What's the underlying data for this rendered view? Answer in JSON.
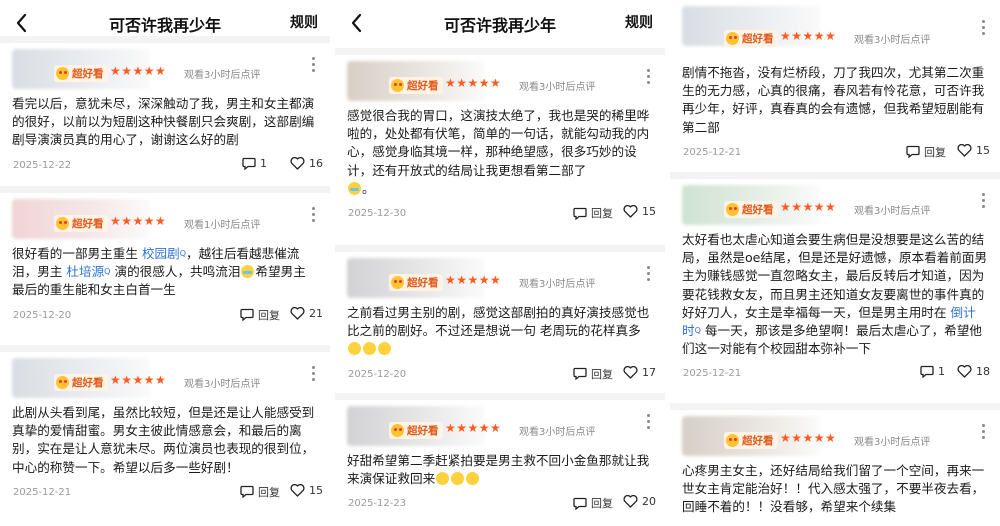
{
  "header": {
    "title": "可否许我再少年",
    "rules_label": "规则"
  },
  "rating_badge": "超好看",
  "stars": "★★★★★",
  "reply_label": "回复",
  "panels": [
    {
      "cards": [
        {
          "time_ago": "观看3小时后点评",
          "text": "看完以后，意犹未尽，深深触动了我，男主和女主都演的很好，以前以为短剧这种快餐剧只会爽剧，这部剧编剧导演演员真的用心了，谢谢这么好的剧",
          "date": "2025-12-22",
          "replies": "1",
          "likes": "16"
        },
        {
          "time_ago": "观看1小时后点评",
          "text_a": "很好看的一部男主重生 ",
          "link1": "校园剧",
          "text_b": "，越往后看越悲催流泪，男主 ",
          "link2": "杜培源",
          "text_c": " 演的很感人，共鸣流泪",
          "text_d": "希望男主最后的重生能和女主白首一生",
          "date": "2025-12-20",
          "likes": "21"
        },
        {
          "time_ago": "观看3小时后点评",
          "text": "此剧从头看到尾，虽然比较短，但是还是让人能感受到真挚的爱情甜蜜。男女主彼此情感意会，和最后的离别，实在是让人意犹未尽。两位演员也表现的很到位，中心的称赞一下。希望以后多一些好剧！",
          "date": "2025-12-21",
          "likes": "15"
        }
      ]
    },
    {
      "cards": [
        {
          "time_ago": "观看3小时后点评",
          "text": "感觉很合我的胃口，这演技太绝了，我也是哭的稀里哗啦的，处处都有伏笔，简单的一句话，就能勾动我的内心，感觉身临其境一样，那种绝望感，很多巧妙的设计，还有开放式的结局让我更想看第二部了",
          "text_end": "。",
          "date": "2025-12-30",
          "likes": "15"
        },
        {
          "time_ago": "观看3小时后点评",
          "text": "之前看过男主别的剧，感觉这部剧拍的真好演技感觉也比之前的剧好。不过还是想说一句 老周玩的花样真多",
          "date": "2025-12-20",
          "likes": "17"
        },
        {
          "time_ago": "观看3小时后点评",
          "text": "好甜希望第二季赶紧拍要是男主救不回小金鱼那就让我来演保证救回来",
          "date": "2025-12-23",
          "likes": "20"
        }
      ]
    },
    {
      "cards": [
        {
          "time_ago": "观看3小时后点评",
          "text": "剧情不拖沓，没有烂桥段，刀了我四次，尤其第二次重生的无力感，心真的很痛，春风若有怜花意，可否许我再少年，好评，真春真的会有遗憾，但我希望短剧能有第二部",
          "date": "2025-12-21",
          "likes": "15"
        },
        {
          "time_ago": "观看3小时后点评",
          "text_a": "太好看也太虐心知道会要生病但是没想要是这么苦的结局，虽然是oe结尾，但是还是好遗憾，原本看着前面男主为赚钱感觉一直忽略女主，最后反转后才知道，因为要花钱救女友，而且男主还知道女友要离世的事件真的好好刀人，女主是幸福每一天，但是男主用时在 ",
          "link1": "倒计时",
          "text_b": " 每一天，那该是多绝望啊！最后太虐心了，希望他们这一对能有个校园甜本弥补一下",
          "date": "2025-12-21",
          "replies": "1",
          "likes": "18"
        },
        {
          "time_ago": "观看3小时后点评",
          "text": "心疼男主女主，还好结局给我们留了一个空间，再来一世女主肯定能治好！！代入感太强了，不要半夜去看，回睡不着的！！没看够，希望来个续集"
        }
      ]
    }
  ]
}
